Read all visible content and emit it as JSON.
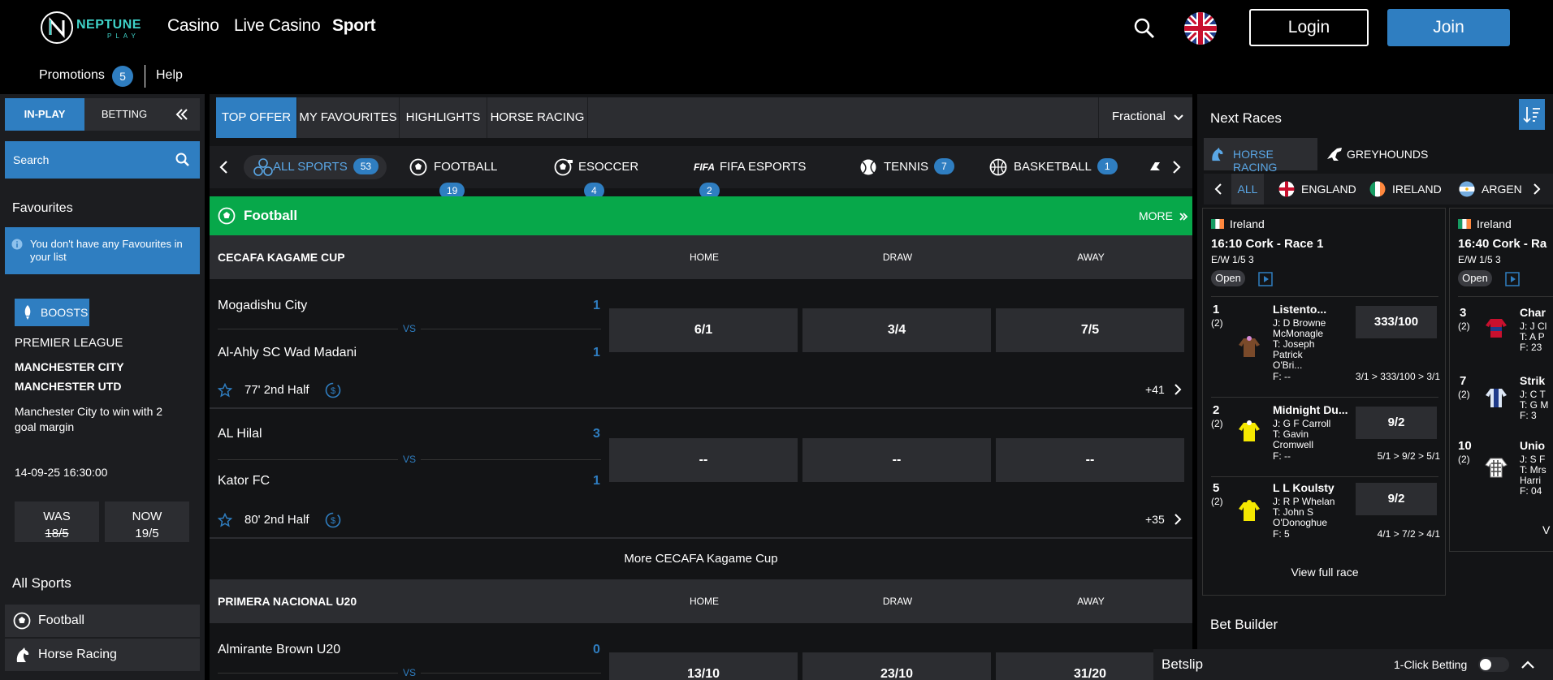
{
  "header": {
    "logo_text": "NEPTUNE",
    "logo_sub": "PLAY",
    "nav": [
      "Casino",
      "Live Casino",
      "Sport"
    ],
    "login_label": "Login",
    "join_label": "Join",
    "promotions_label": "Promotions",
    "promotions_count": "5",
    "help_label": "Help"
  },
  "sidebar": {
    "tabs": [
      "IN-PLAY",
      "BETTING"
    ],
    "search_placeholder": "Search",
    "favourites_title": "Favourites",
    "favourites_empty": "You don't have any Favourites in your list",
    "boosts_label": "BOOSTS",
    "boost": {
      "league": "PREMIER LEAGUE",
      "team1": "MANCHESTER CITY",
      "team2": "MANCHESTER UTD",
      "desc": "Manchester City to win with 2 goal margin",
      "datetime": "14-09-25 16:30:00",
      "was_label": "WAS",
      "was_value": "18/5",
      "now_label": "NOW",
      "now_value": "19/5"
    },
    "all_sports_title": "All Sports",
    "sports": [
      "Football",
      "Horse Racing"
    ]
  },
  "main": {
    "tabs": [
      "TOP OFFER",
      "MY FAVOURITES",
      "HIGHLIGHTS",
      "HORSE RACING"
    ],
    "odds_format": "Fractional",
    "sports": [
      {
        "label": "ALL SPORTS",
        "count": "53"
      },
      {
        "label": "FOOTBALL",
        "count": "19"
      },
      {
        "label": "ESOCCER",
        "count": "4"
      },
      {
        "label": "FIFA ESPORTS",
        "count": "2"
      },
      {
        "label": "TENNIS",
        "count": "7"
      },
      {
        "label": "BASKETBALL",
        "count": "1"
      }
    ],
    "fifa_prefix": "FIFA",
    "section_title": "Football",
    "more_label": "MORE",
    "columns": [
      "HOME",
      "DRAW",
      "AWAY"
    ],
    "vs_label": "VS",
    "competitions": [
      {
        "name": "CECAFA KAGAME CUP",
        "matches": [
          {
            "home": "Mogadishu City",
            "away": "Al-Ahly SC Wad Madani",
            "home_score": "1",
            "away_score": "1",
            "odds": [
              "6/1",
              "3/4",
              "7/5"
            ],
            "time": "77' 2nd Half",
            "markets": "+41"
          },
          {
            "home": "AL Hilal",
            "away": "Kator FC",
            "home_score": "3",
            "away_score": "1",
            "odds": [
              "--",
              "--",
              "--"
            ],
            "time": "80' 2nd Half",
            "markets": "+35"
          }
        ],
        "more": "More CECAFA Kagame Cup"
      },
      {
        "name": "PRIMERA NACIONAL U20",
        "matches": [
          {
            "home": "Almirante Brown U20",
            "home_score": "0",
            "odds": [
              "13/10",
              "23/10",
              "31/20"
            ]
          }
        ]
      }
    ]
  },
  "right": {
    "next_races_title": "Next Races",
    "tabs": [
      "HORSE RACING",
      "GREYHOUNDS"
    ],
    "filters": [
      "ALL",
      "ENGLAND",
      "IRELAND",
      "ARGEN"
    ],
    "cards": [
      {
        "country": "Ireland",
        "title": "16:10 Cork - Race 1",
        "ew": "E/W 1/5 3",
        "status": "Open",
        "runners": [
          {
            "num": "1",
            "draw": "(2)",
            "name": "Listento...",
            "lines": [
              "J: D Browne",
              "McMonagle",
              "T: Joseph",
              "Patrick",
              "O'Bri...",
              "F: --"
            ],
            "odds": "333/100",
            "hist": "3/1 > 333/100 > 3/1"
          },
          {
            "num": "2",
            "draw": "(2)",
            "name": "Midnight Du...",
            "lines": [
              "J: G F Carroll",
              "T: Gavin",
              "Cromwell",
              "F: --"
            ],
            "odds": "9/2",
            "hist": "5/1 > 9/2 > 5/1"
          },
          {
            "num": "5",
            "draw": "(2)",
            "name": "L L Koulsty",
            "lines": [
              "J: R P Whelan",
              "T: John S",
              "O'Donoghue",
              "F: 5"
            ],
            "odds": "9/2",
            "hist": "4/1 > 7/2 > 4/1"
          }
        ],
        "view_full": "View full race"
      },
      {
        "country": "Ireland",
        "title": "16:40 Cork - Ra",
        "ew": "E/W 1/5 3",
        "status": "Open",
        "runners": [
          {
            "num": "3",
            "draw": "(2)",
            "name": "Char",
            "lines": [
              "J: J Cl",
              "T: A P",
              "F: 23"
            ]
          },
          {
            "num": "7",
            "draw": "(2)",
            "name": "Strik",
            "lines": [
              "J: C T",
              "T: G M",
              "F: 3"
            ]
          },
          {
            "num": "10",
            "draw": "(2)",
            "name": "Unio",
            "lines": [
              "J: S F",
              "T: Mrs",
              "Harri",
              "F: 04"
            ]
          }
        ],
        "view_full": "V"
      }
    ],
    "bet_builder": "Bet Builder",
    "betslip": "Betslip",
    "one_click": "1-Click Betting"
  },
  "colors": {
    "accent": "#2f7ec1",
    "green": "#07a84a",
    "panel": "#2c2d31"
  }
}
